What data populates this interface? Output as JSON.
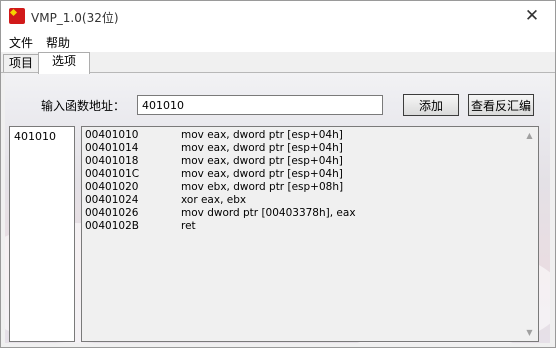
{
  "window": {
    "title": "VMP_1.0(32位)",
    "close_glyph": "✕"
  },
  "menu": [
    "文件",
    "帮助"
  ],
  "tabs": [
    "项目",
    "选项"
  ],
  "form": {
    "label": "输入函数地址：",
    "value": "401010",
    "add_label": "添加",
    "view_label": "查看反汇编"
  },
  "functions": [
    "401010"
  ],
  "disassembly": [
    {
      "addr": "00401010",
      "asm": "mov eax, dword ptr [esp+04h]"
    },
    {
      "addr": "00401014",
      "asm": "mov eax, dword ptr [esp+04h]"
    },
    {
      "addr": "00401018",
      "asm": "mov eax, dword ptr [esp+04h]"
    },
    {
      "addr": "0040101C",
      "asm": "mov eax, dword ptr [esp+04h]"
    },
    {
      "addr": "00401020",
      "asm": "mov ebx, dword ptr [esp+08h]"
    },
    {
      "addr": "00401024",
      "asm": "xor eax, ebx"
    },
    {
      "addr": "00401026",
      "asm": "mov dword ptr [00403378h], eax"
    },
    {
      "addr": "0040102B",
      "asm": "ret"
    }
  ],
  "icons": {
    "app": "app-flag-icon",
    "close": "close-icon",
    "scroll_up": "scroll-up-arrow-icon",
    "scroll_down": "scroll-down-arrow-icon"
  }
}
